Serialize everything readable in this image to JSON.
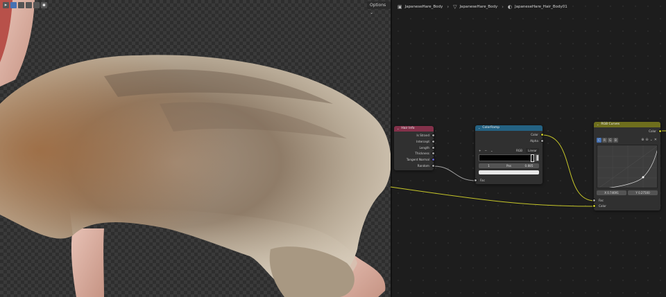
{
  "viewport": {
    "options_label": "Options ⌄",
    "toolbar": [
      "▸",
      "",
      "",
      "",
      "",
      "▪"
    ]
  },
  "breadcrumb": {
    "items": [
      {
        "icon": "object-icon",
        "label": "JapaneseHare_Body"
      },
      {
        "icon": "mesh-icon",
        "label": "JapaneseHare_Body"
      },
      {
        "icon": "material-icon",
        "label": "JapaneseHare_Hair_Body01"
      }
    ]
  },
  "nodes": {
    "hair_info": {
      "title": "Hair Info",
      "outputs": [
        "Is Strand",
        "Intercept",
        "Length",
        "Thickness",
        "Tangent Normal",
        "Random"
      ]
    },
    "color_ramp": {
      "title": "ColorRamp",
      "outputs": [
        "Color",
        "Alpha"
      ],
      "inputs": [
        "Fac"
      ],
      "controls": {
        "add": "+",
        "remove": "−",
        "menu": "⌄",
        "color_mode": "RGB",
        "interpolation": "Linear"
      },
      "stop_index": "1",
      "pos_label": "Pos",
      "pos_value": "0.885"
    },
    "rgb_curves": {
      "title": "RGB Curves",
      "outputs": [
        "Color"
      ],
      "inputs": [
        "Fac",
        "Color"
      ],
      "tabs": [
        "C",
        "R",
        "G",
        "B"
      ],
      "tools": [
        "⊕",
        "⊖",
        "⌄",
        "✕"
      ],
      "coord_x": "X 0.74691",
      "coord_y": "Y 0.27500"
    }
  },
  "colors": {
    "hair_header": "#83314a",
    "ramp_header": "#246283",
    "curves_header": "#6e6e1d",
    "wire_yellow": "#c7c729",
    "wire_grey": "#a1a1a1"
  }
}
